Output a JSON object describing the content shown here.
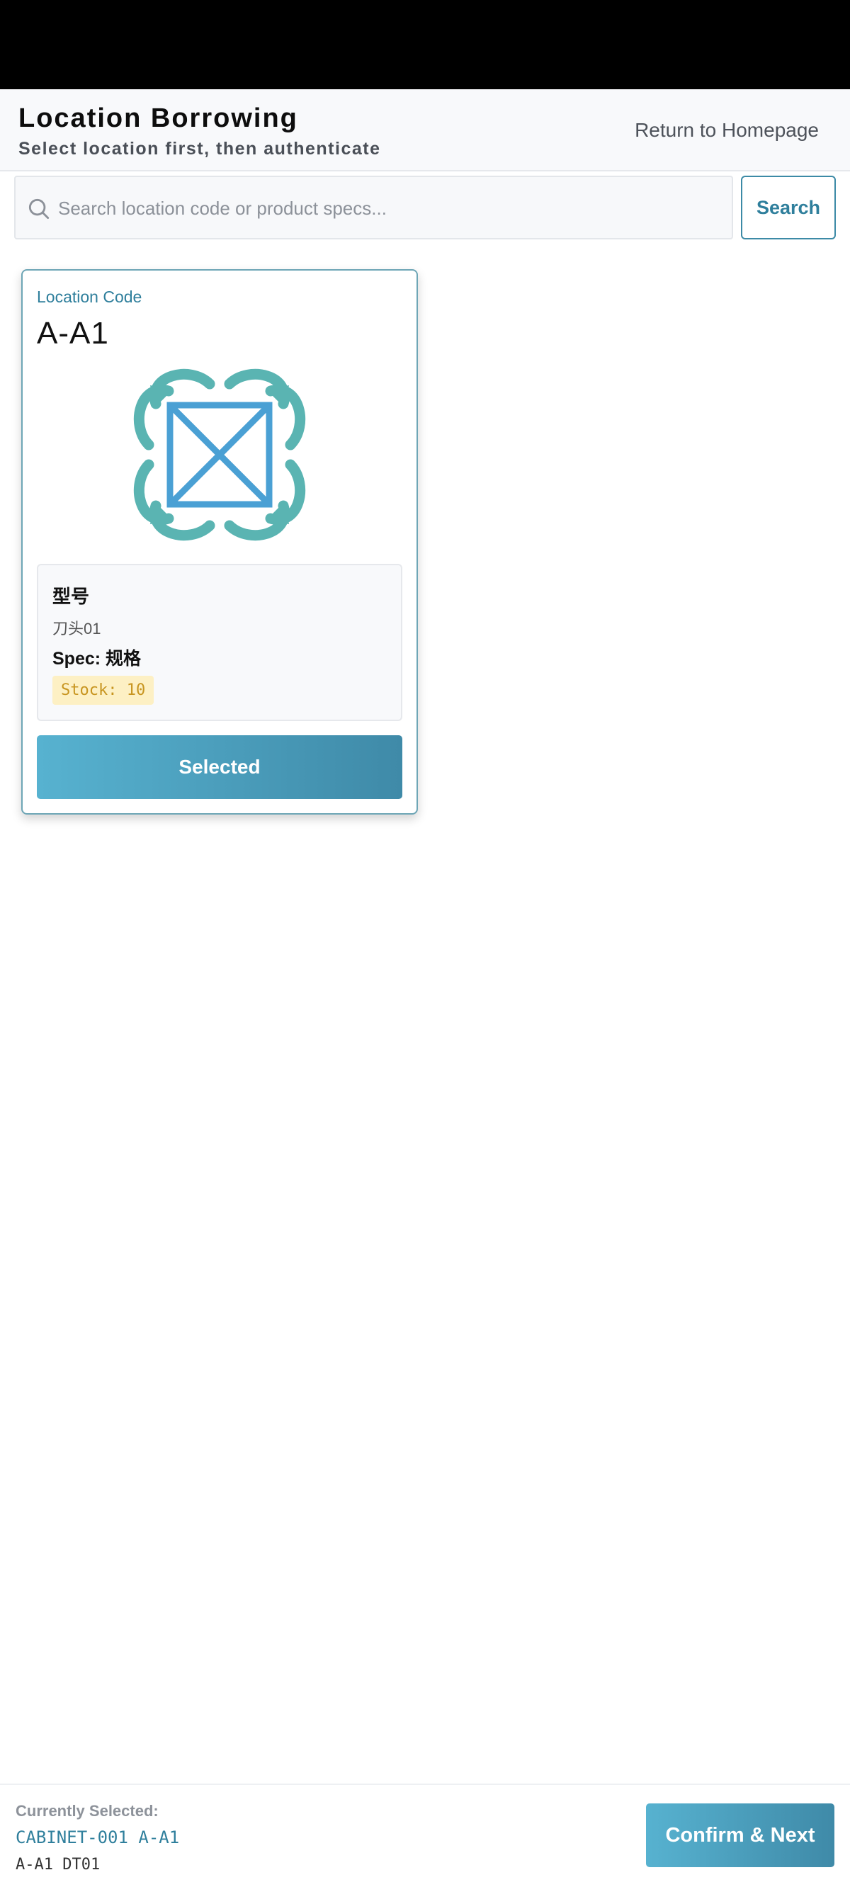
{
  "header": {
    "title": "Location Borrowing",
    "subtitle": "Select location first, then authenticate",
    "home_link": "Return to Homepage"
  },
  "search": {
    "placeholder": "Search location code or product specs...",
    "value": "",
    "button_label": "Search"
  },
  "card": {
    "label": "Location Code",
    "code": "A-A1",
    "image_icon": "product-placeholder-icon",
    "model_title": "型号",
    "model_code": "刀头01",
    "spec": "Spec: 规格",
    "stock": "Stock: 10",
    "button_label": "Selected"
  },
  "footer": {
    "label": "Currently Selected:",
    "cabinet": "CABINET-001 A-A1",
    "detail": "A-A1 DT01",
    "confirm_label": "Confirm & Next"
  },
  "colors": {
    "accent": "#3f8aa8",
    "accent_light": "#57b2d0",
    "logo_teal": "#5ab4b2",
    "logo_blue": "#4aa0d4",
    "stock_bg": "#fdf0c4",
    "stock_text": "#c89520"
  }
}
